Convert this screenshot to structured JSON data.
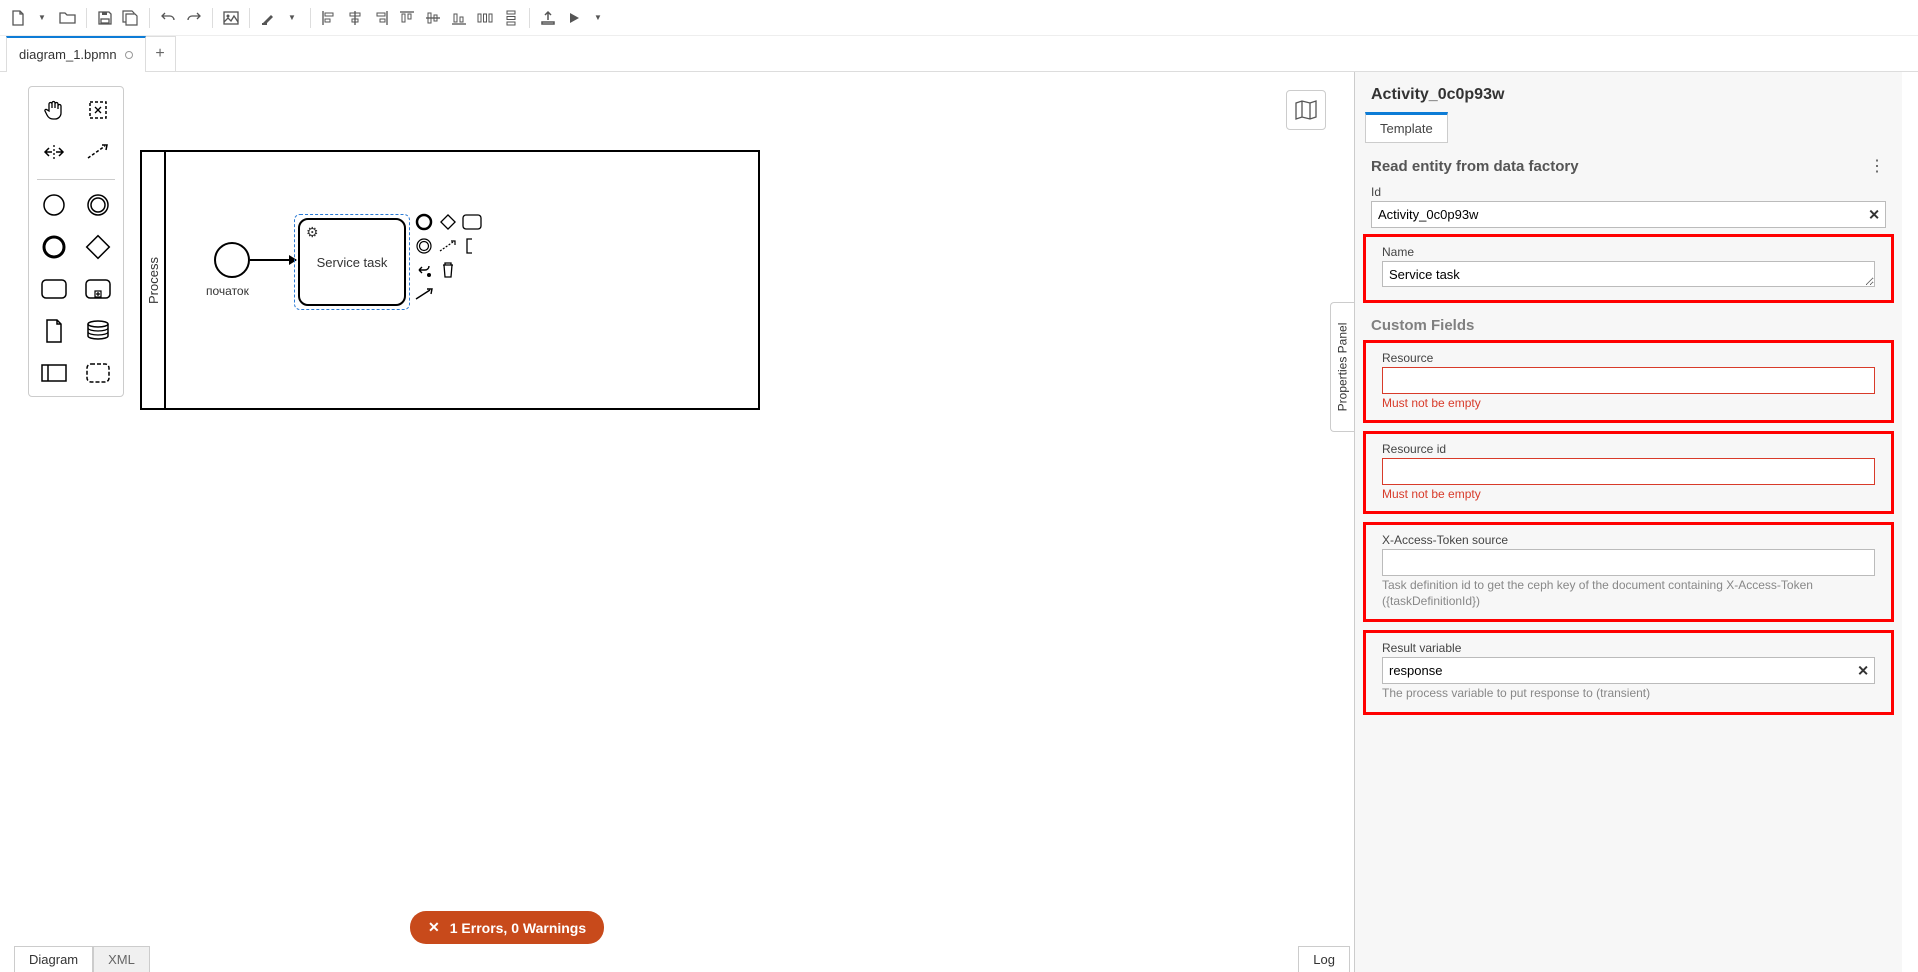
{
  "file_tab": "diagram_1.bpmn",
  "lane_label": "Process",
  "start_event_label": "початок",
  "task_label": "Service task",
  "minimap_icon": "map",
  "vtab_label": "Properties Panel",
  "props": {
    "title": "Activity_0c0p93w",
    "tab": "Template",
    "group_title": "Read entity from data factory",
    "fields": {
      "id": {
        "label": "Id",
        "value": "Activity_0c0p93w"
      },
      "name": {
        "label": "Name",
        "value": "Service task"
      },
      "custom_fields_title": "Custom Fields",
      "resource": {
        "label": "Resource",
        "value": "",
        "error": "Must not be empty"
      },
      "resource_id": {
        "label": "Resource id",
        "value": "",
        "error": "Must not be empty"
      },
      "token": {
        "label": "X-Access-Token source",
        "value": "",
        "hint": "Task definition id to get the ceph key of the document containing X-Access-Token ({taskDefinitionId})"
      },
      "result": {
        "label": "Result variable",
        "value": "response",
        "hint": "The process variable to put response to (transient)"
      }
    }
  },
  "error_pill": "1 Errors, 0 Warnings",
  "bottom": {
    "diagram": "Diagram",
    "xml": "XML",
    "log": "Log"
  }
}
